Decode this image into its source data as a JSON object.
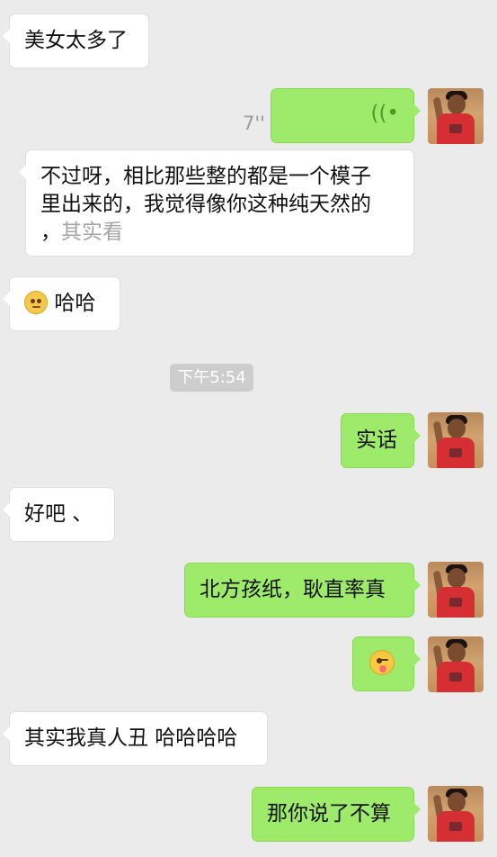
{
  "messages": {
    "m1": "美女太多了",
    "voice_duration": "7''",
    "m3_line1": "不过呀，相比那些整的都是一个模子",
    "m3_line2": "里出来的，我觉得像你这种纯天然的",
    "m3_line3_prefix": "，",
    "m3_line3_faded": "其实看",
    "m4": "哈哈",
    "timestamp": "下午5:54",
    "m6": "实话",
    "m7": "好吧 、",
    "m8": "北方孩纸，耿直率真",
    "m10": "其实我真人丑 哈哈哈哈",
    "m11": "那你说了不算"
  },
  "icons": {
    "voice": "voice-wave-icon",
    "emoji_sheepish": "sheepish-smile-emoji",
    "emoji_wink": "wink-tongue-emoji"
  },
  "colors": {
    "background": "#ebebeb",
    "incoming_bubble": "#ffffff",
    "outgoing_bubble": "#9eea6a"
  }
}
